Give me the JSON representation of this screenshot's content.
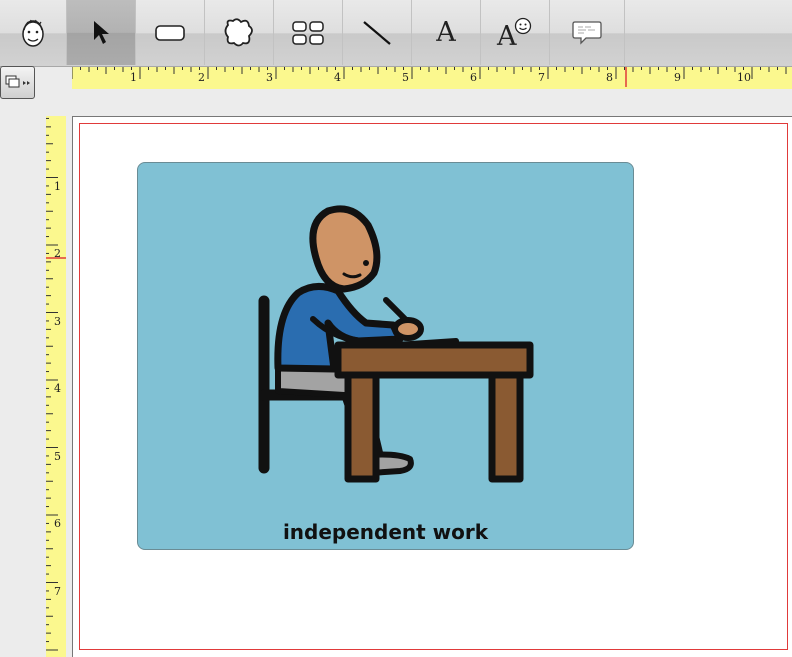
{
  "toolbar": {
    "tools": [
      {
        "name": "face-icon"
      },
      {
        "name": "pointer-arrow-icon",
        "selected": true
      },
      {
        "name": "rounded-rectangle-icon"
      },
      {
        "name": "freeform-shape-icon"
      },
      {
        "name": "grid-buttons-icon"
      },
      {
        "name": "line-icon"
      },
      {
        "name": "text-icon",
        "glyph": "A"
      },
      {
        "name": "symbol-text-icon",
        "glyph": "A"
      },
      {
        "name": "speech-bubble-icon"
      }
    ]
  },
  "rulers": {
    "horizontal_labels": [
      "1",
      "2",
      "3",
      "4",
      "5",
      "6",
      "7",
      "8",
      "9",
      "10"
    ],
    "vertical_labels": [
      "1",
      "2",
      "3",
      "4",
      "5",
      "6",
      "7"
    ],
    "marker_color": "#e03a3a"
  },
  "canvas": {
    "card_color": "#80c1d4",
    "symbol_caption": "independent work"
  }
}
